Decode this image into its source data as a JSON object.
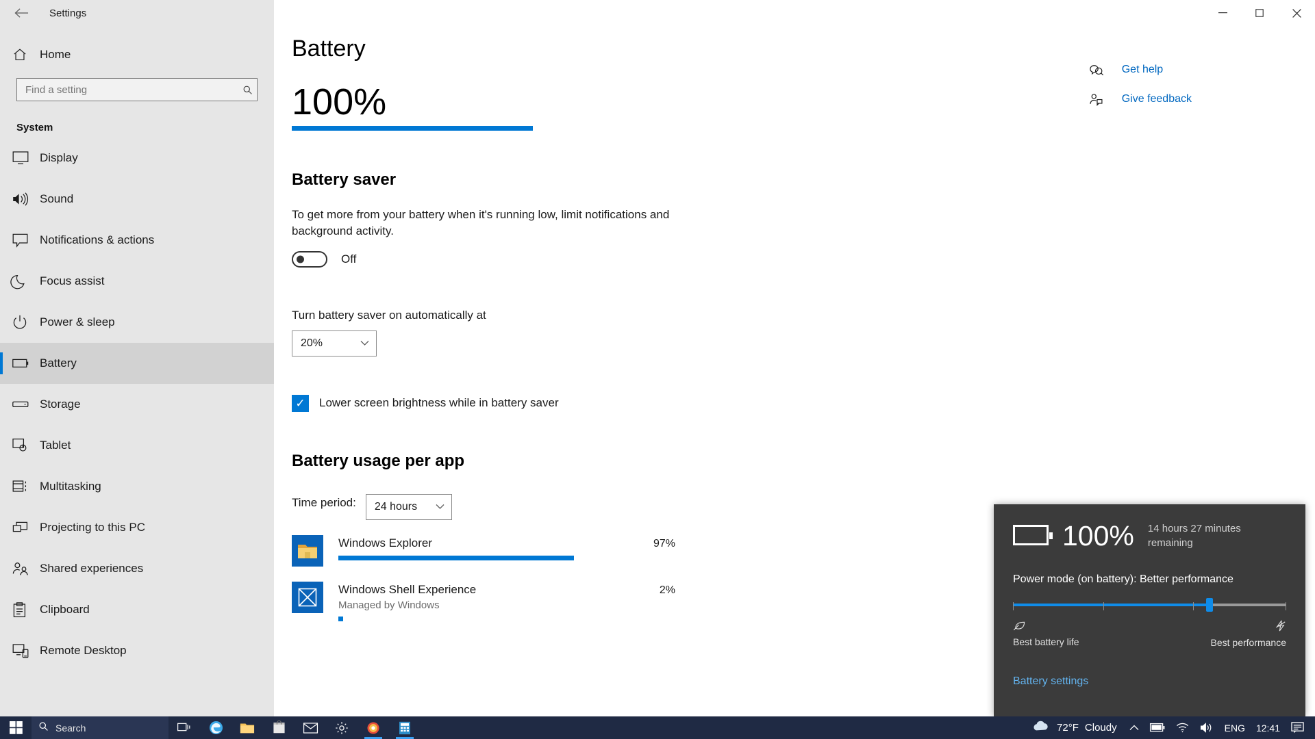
{
  "window": {
    "title": "Settings",
    "back_label": "←",
    "minimize_label": "—",
    "maximize_label": "▢",
    "close_label": "✕"
  },
  "sidebar": {
    "home_label": "Home",
    "search_placeholder": "Find a setting",
    "search_value": "",
    "section_title": "System",
    "items": [
      {
        "label": "Display",
        "icon": "monitor-icon",
        "selected": false
      },
      {
        "label": "Sound",
        "icon": "speaker-icon",
        "selected": false
      },
      {
        "label": "Notifications & actions",
        "icon": "chat-bubble-icon",
        "selected": false
      },
      {
        "label": "Focus assist",
        "icon": "moon-icon",
        "selected": false
      },
      {
        "label": "Power & sleep",
        "icon": "power-icon",
        "selected": false
      },
      {
        "label": "Battery",
        "icon": "battery-icon",
        "selected": true
      },
      {
        "label": "Storage",
        "icon": "drive-icon",
        "selected": false
      },
      {
        "label": "Tablet",
        "icon": "tablet-icon",
        "selected": false
      },
      {
        "label": "Multitasking",
        "icon": "multitasking-icon",
        "selected": false
      },
      {
        "label": "Projecting to this PC",
        "icon": "projecting-icon",
        "selected": false
      },
      {
        "label": "Shared experiences",
        "icon": "shared-icon",
        "selected": false
      },
      {
        "label": "Clipboard",
        "icon": "clipboard-icon",
        "selected": false
      },
      {
        "label": "Remote Desktop",
        "icon": "remote-desktop-icon",
        "selected": false
      }
    ]
  },
  "main": {
    "page_title": "Battery",
    "battery_percent_text": "100%",
    "battery_percent_value": 100,
    "help_links": [
      {
        "label": "Get help",
        "icon": "help-icon"
      },
      {
        "label": "Give feedback",
        "icon": "feedback-icon"
      }
    ],
    "battery_saver": {
      "heading": "Battery saver",
      "description": "To get more from your battery when it's running low, limit notifications and background activity.",
      "toggle_state": "Off",
      "auto_label": "Turn battery saver on automatically at",
      "auto_value": "20%",
      "checkbox_label": "Lower screen brightness while in battery saver",
      "checkbox_checked": true,
      "check_glyph": "✓"
    },
    "usage": {
      "heading": "Battery usage per app",
      "time_period_label": "Time period:",
      "time_period_value": "24 hours",
      "apps": [
        {
          "name": "Windows Explorer",
          "percent_text": "97%",
          "percent_value": 97,
          "subtitle": "",
          "icon": "folder-icon"
        },
        {
          "name": "Windows Shell Experience",
          "percent_text": "2%",
          "percent_value": 2,
          "subtitle": "Managed by Windows",
          "icon": "shell-icon"
        }
      ]
    }
  },
  "battery_flyout": {
    "percent_text": "100%",
    "remaining_text": "14 hours 27 minutes remaining",
    "power_mode_text": "Power mode (on battery): Better performance",
    "slider_position_percent": 72,
    "left_label": "Best battery life",
    "right_label": "Best performance",
    "left_icon_glyph": "🍃",
    "right_icon_glyph": "⚡",
    "settings_link": "Battery settings"
  },
  "taskbar": {
    "search_label": "Search",
    "weather_temp": "72°F",
    "weather_condition": "Cloudy",
    "language": "ENG",
    "clock": "12:41",
    "icons": [
      "task-view-icon",
      "edge-icon",
      "file-explorer-icon",
      "store-icon",
      "mail-icon",
      "settings-icon",
      "photos-icon",
      "calculator-icon"
    ],
    "tray_icons": [
      "chevron-up-icon",
      "battery-tray-icon",
      "wifi-icon",
      "volume-icon",
      "notification-icon"
    ]
  },
  "colors": {
    "accent": "#0078d4",
    "link": "#0067c0",
    "sidebar_bg": "#e6e6e6",
    "taskbar_bg": "#1f2a44",
    "flyout_bg": "#3b3b3b"
  }
}
